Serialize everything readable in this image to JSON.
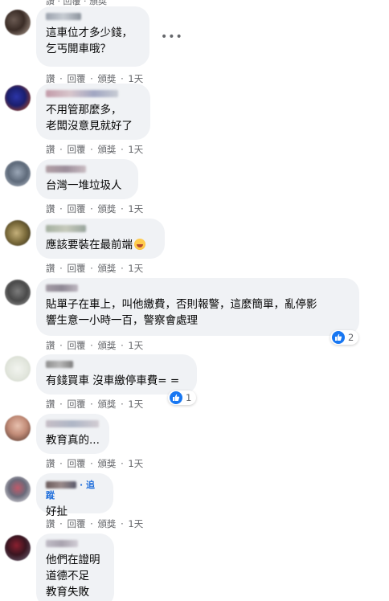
{
  "action_labels": {
    "like": "讚",
    "reply": "回覆",
    "award": "頒獎",
    "time": "1天",
    "sep": "·"
  },
  "comments": [
    {
      "lines": [
        "這車位才多少錢，",
        "乞丐開車哦？"
      ],
      "has_more_menu": true,
      "more_icon": "more-horizontal-icon"
    },
    {
      "lines": [
        "不用管那麼多，",
        "老闆沒意見就好了"
      ]
    },
    {
      "lines": [
        "台灣一堆垃圾人"
      ]
    },
    {
      "lines": [
        "應該要裝在最前端"
      ],
      "emoji": "rolling-on-floor-laughing-emoji"
    },
    {
      "lines": [
        "貼單子在車上，叫他繳費，否則報警，這麼簡單，亂停影",
        "響生意一小時一百，警察會處理"
      ],
      "reactions": {
        "icon": "thumbs-up-icon",
        "count": "2"
      }
    },
    {
      "lines": [
        "有錢買車 沒車繳停車費= ="
      ],
      "reactions": {
        "icon": "thumbs-up-icon",
        "count": "1"
      }
    },
    {
      "lines": [
        "教育真的..."
      ]
    },
    {
      "lines": [
        "好扯"
      ],
      "follow_label": "追蹤"
    },
    {
      "lines": [
        "他們在證明",
        "道德不足",
        "教育失敗"
      ]
    }
  ],
  "colors": {
    "bubble_bg": "#f0f2f5",
    "meta_text": "#65676b",
    "like_blue": "#1877f2",
    "follow_blue": "#216fdb"
  }
}
